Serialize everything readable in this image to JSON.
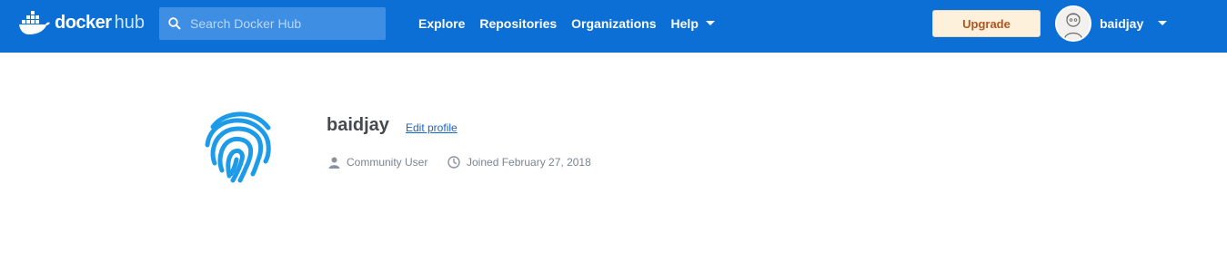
{
  "header": {
    "logo_word1": "docker",
    "logo_word2": "hub",
    "search_placeholder": "Search Docker Hub",
    "nav": [
      "Explore",
      "Repositories",
      "Organizations",
      "Help"
    ],
    "upgrade_label": "Upgrade",
    "username": "baidjay",
    "colors": {
      "bar": "#0b6fd6",
      "upgrade_bg": "#fdf1dc",
      "upgrade_text": "#b5541f"
    }
  },
  "profile": {
    "name": "baidjay",
    "edit_label": "Edit profile",
    "role": "Community User",
    "joined": "Joined February 27, 2018",
    "avatar_color": "#1e9be8"
  }
}
